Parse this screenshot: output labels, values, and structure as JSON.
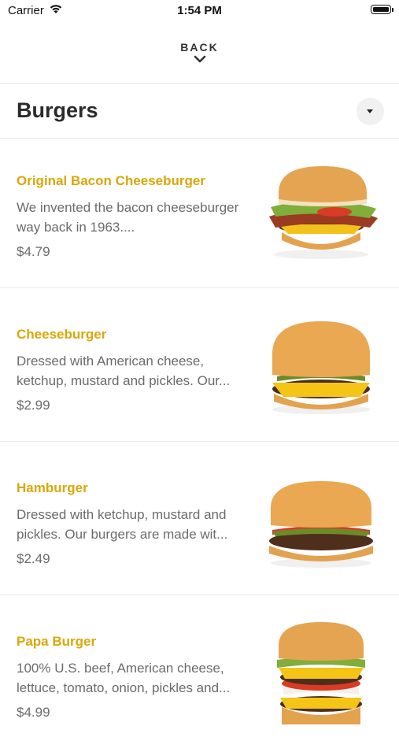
{
  "status_bar": {
    "carrier": "Carrier",
    "time": "1:54 PM"
  },
  "nav": {
    "back_label": "BACK"
  },
  "section": {
    "title": "Burgers"
  },
  "items": [
    {
      "name": "Original Bacon Cheeseburger",
      "description": "We invented the bacon cheeseburger way back in 1963....",
      "price": "$4.79"
    },
    {
      "name": "Cheeseburger",
      "description": "Dressed with American cheese, ketchup, mustard and pickles. Our...",
      "price": "$2.99"
    },
    {
      "name": "Hamburger",
      "description": "Dressed with ketchup, mustard and pickles. Our burgers are made wit...",
      "price": "$2.49"
    },
    {
      "name": "Papa Burger",
      "description": "100% U.S. beef, American cheese, lettuce, tomato, onion, pickles and...",
      "price": "$4.99"
    }
  ],
  "colors": {
    "accent": "#d9a70a",
    "text_muted": "#6b6b6b",
    "divider": "#e8e8e8"
  }
}
